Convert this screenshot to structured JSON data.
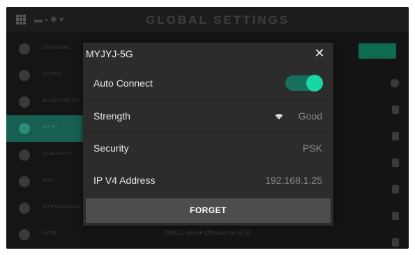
{
  "background_app": {
    "title": "GLOBAL SETTINGS",
    "sidebar": [
      {
        "icon": "gear-icon",
        "label": "GENERAL"
      },
      {
        "icon": "video-icon",
        "label": "VIDEO"
      },
      {
        "icon": "bluetooth-icon",
        "label": "BLUETOOTH"
      },
      {
        "icon": "wifi-icon",
        "label": "WI-FI",
        "active": true
      },
      {
        "icon": "controller-icon",
        "label": "USB DATA"
      },
      {
        "icon": "mic-icon",
        "label": "AMP"
      },
      {
        "icon": "expression-icon",
        "label": "EXPRESSION"
      },
      {
        "icon": "info-icon",
        "label": "INFO"
      }
    ],
    "network_hint": "DIRECT-4A-HP OfficeJet Pro 8710",
    "accent": "#0f6a52"
  },
  "dialog": {
    "title": "MYJYJ-5G",
    "close_icon": "close-icon",
    "rows": {
      "auto_connect": {
        "label": "Auto Connect",
        "enabled": true
      },
      "strength": {
        "label": "Strength",
        "value": "Good",
        "icon": "wifi-signal-icon"
      },
      "security": {
        "label": "Security",
        "value": "PSK"
      },
      "ip": {
        "label": "IP V4 Address",
        "value": "192.168.1.25"
      }
    },
    "forget_label": "FORGET",
    "toggle_color": "#18d7a2"
  }
}
